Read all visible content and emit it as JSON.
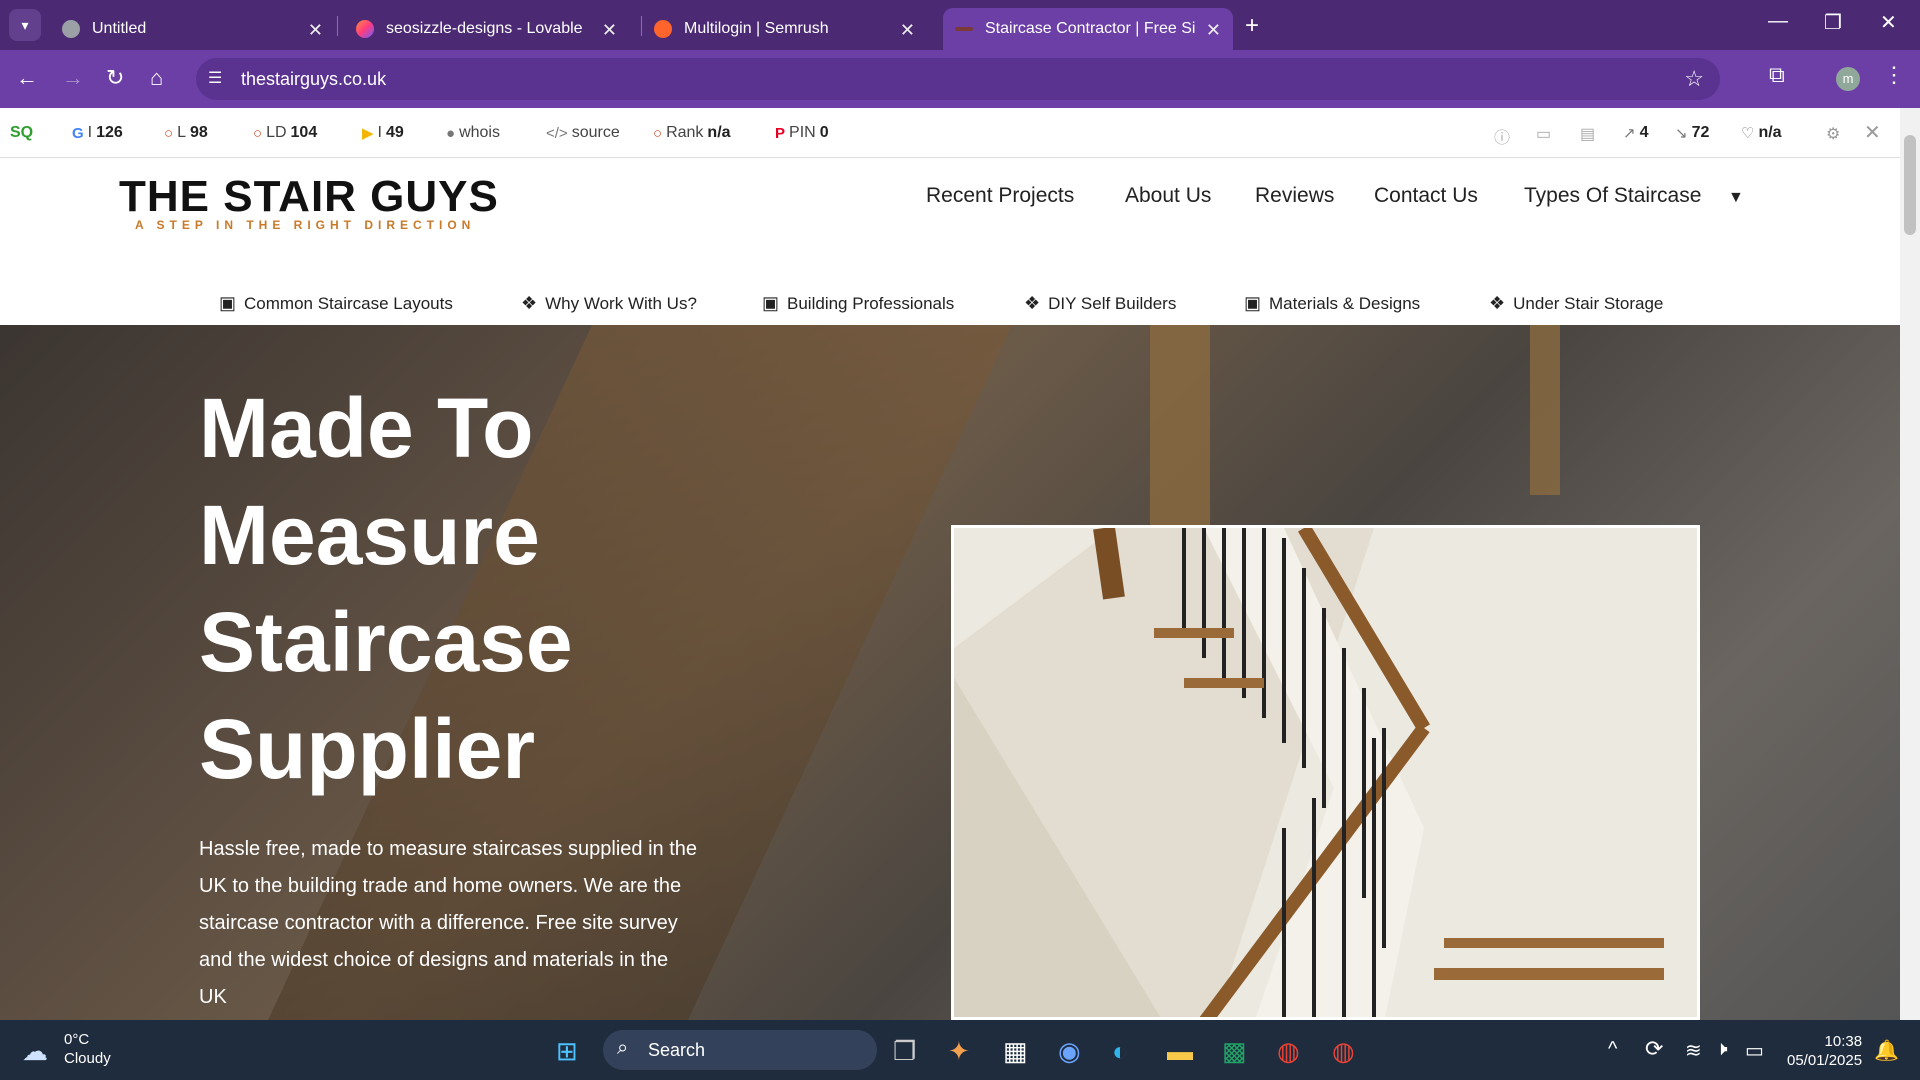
{
  "browser": {
    "tabs": [
      {
        "title": "Untitled",
        "active": false
      },
      {
        "title": "seosizzle-designs - Lovable",
        "active": false
      },
      {
        "title": "Multilogin | Semrush",
        "active": false
      },
      {
        "title": "Staircase Contractor | Free Site",
        "active": true
      }
    ],
    "url": "thestairguys.co.uk",
    "avatar_letter": "m"
  },
  "seobar": {
    "google_index": "126",
    "links": "98",
    "ld": "104",
    "bing_index": "49",
    "whois": "whois",
    "source": "source",
    "rank_label": "Rank",
    "rank": "n/a",
    "pin_label": "PIN",
    "pin": "0",
    "external_links": "4",
    "internal_links": "72",
    "health": "n/a"
  },
  "site": {
    "logo_title": "THE STAIR GUYS",
    "logo_tagline": "A STEP IN THE RIGHT DIRECTION",
    "main_nav": [
      "Recent Projects",
      "About Us",
      "Reviews",
      "Contact Us",
      "Types Of Staircase"
    ],
    "sub_nav": [
      "Common Staircase Layouts",
      "Why Work With Us?",
      "Building Professionals",
      "DIY Self Builders",
      "Materials & Designs",
      "Under Stair Storage"
    ],
    "hero_title": "Made To Measure Staircase Supplier",
    "hero_text": "Hassle free, made to measure staircases supplied in the UK to the building trade and home owners. We are the staircase contractor with a difference.  Free site survey and the widest choice of designs and materials in the UK"
  },
  "taskbar": {
    "temperature": "0°C",
    "weather": "Cloudy",
    "search": "Search",
    "time": "10:38",
    "date": "05/01/2025"
  }
}
